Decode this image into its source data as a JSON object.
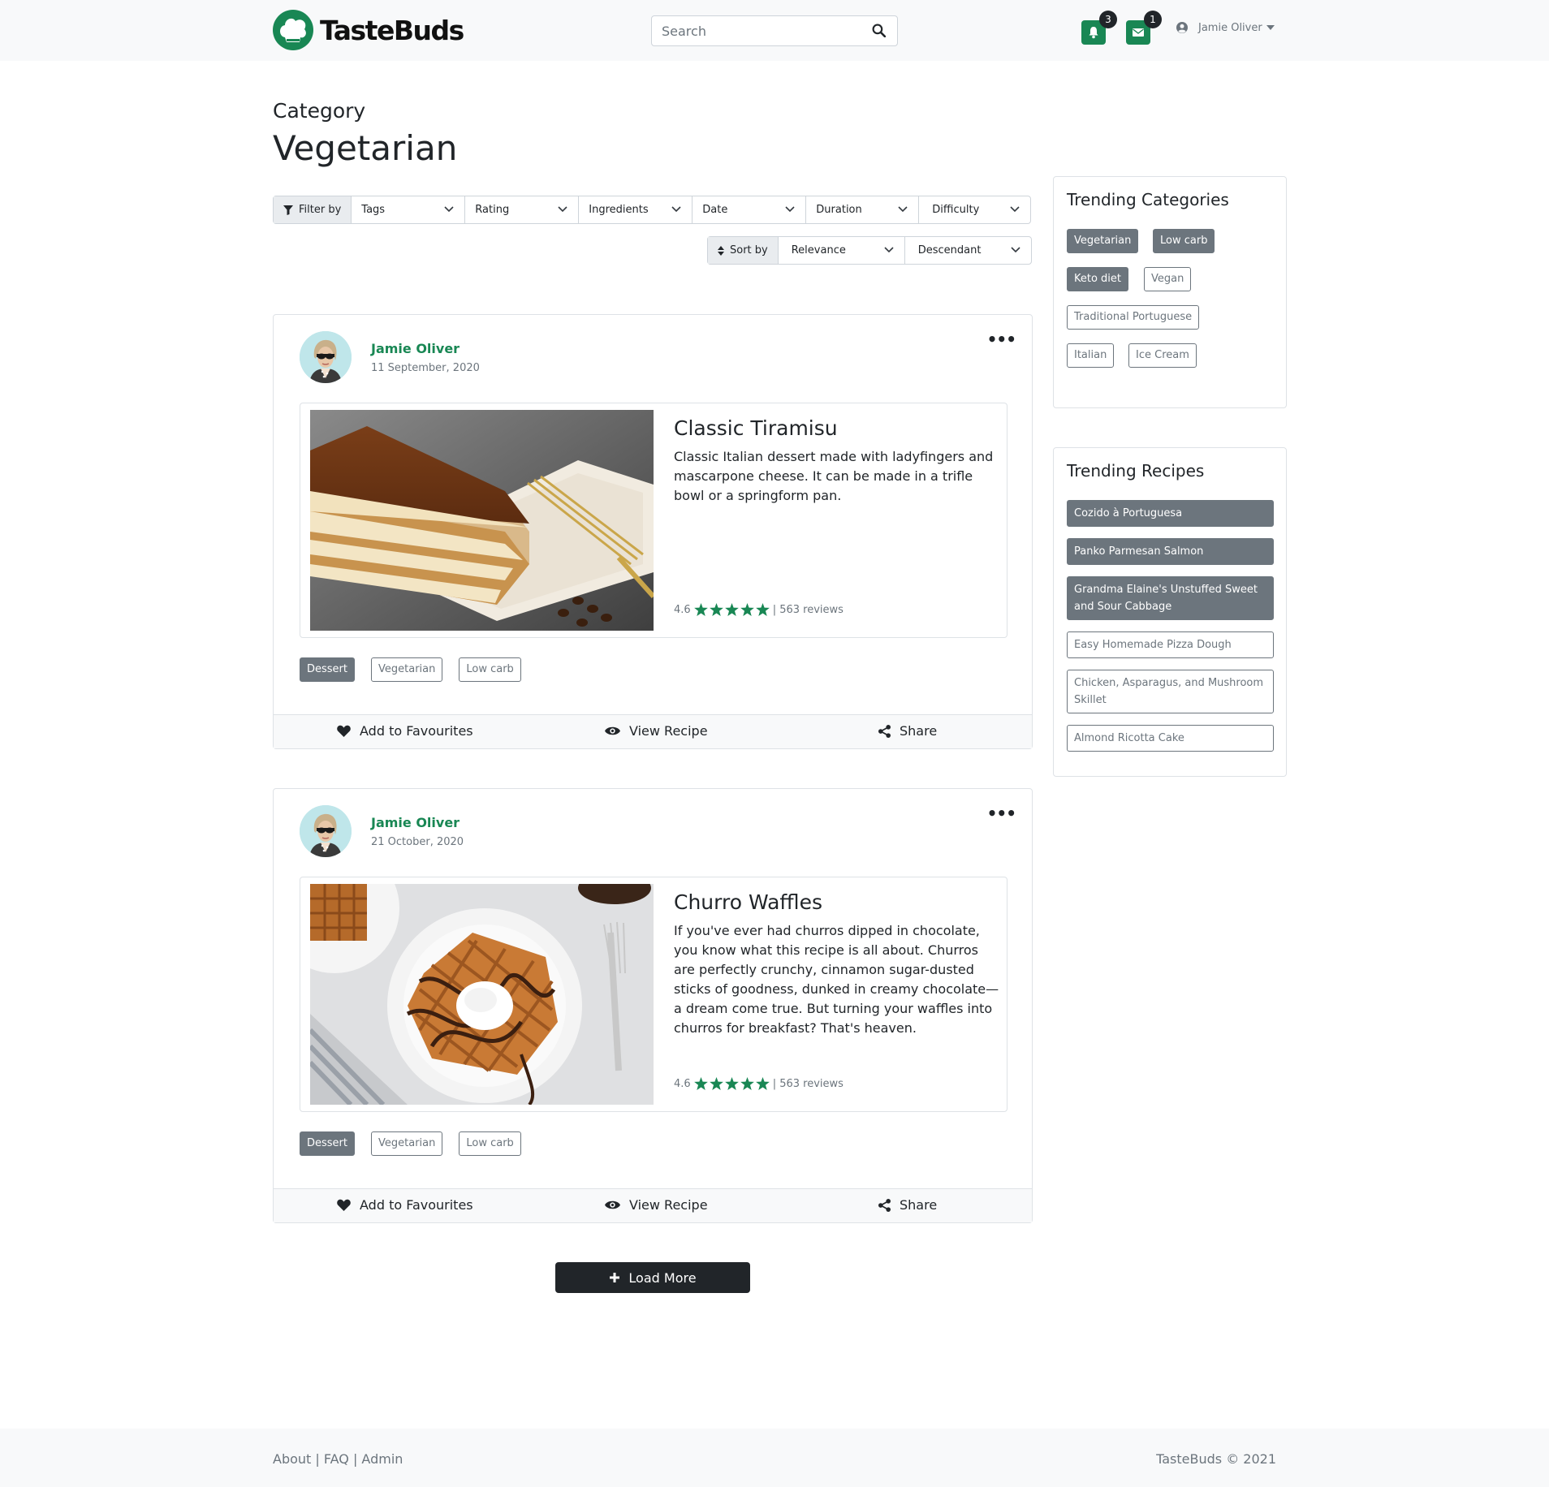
{
  "brand": {
    "name": "TasteBuds",
    "color": "#198754"
  },
  "search": {
    "placeholder": "Search"
  },
  "notifications": {
    "count": "3"
  },
  "messages": {
    "count": "1"
  },
  "user": {
    "name": "Jamie Oliver"
  },
  "page": {
    "category_label": "Category",
    "category_name": "Vegetarian"
  },
  "filters": {
    "label": "Filter by",
    "items": [
      "Tags",
      "Rating",
      "Ingredients",
      "Date",
      "Duration",
      "Difficulty"
    ]
  },
  "sort": {
    "label": "Sort by",
    "field": "Relevance",
    "order": "Descendant"
  },
  "posts": [
    {
      "author": "Jamie Oliver",
      "date": "11 September, 2020",
      "title": "Classic Tiramisu",
      "description": "Classic Italian dessert made with ladyfingers and mascarpone cheese. It can be made in a trifle bowl or a springform pan.",
      "rating": "4.6",
      "stars": 5,
      "reviews": "| 563 reviews",
      "tags": [
        "Dessert",
        "Vegetarian",
        "Low carb"
      ],
      "image": "tiramisu-photo"
    },
    {
      "author": "Jamie Oliver",
      "date": "21 October, 2020",
      "title": "Churro Waffles",
      "description": "If you've ever had churros dipped in chocolate, you know what this recipe is all about. Churros are perfectly crunchy, cinnamon sugar-dusted sticks of goodness, dunked in creamy chocolate—a dream come true. But turning your waffles into churros for breakfast? That's heaven.",
      "rating": "4.6",
      "stars": 5,
      "reviews": "| 563 reviews",
      "tags": [
        "Dessert",
        "Vegetarian",
        "Low carb"
      ],
      "image": "churro-waffles-photo"
    }
  ],
  "actions": {
    "favourite": "Add to Favourites",
    "view": "View Recipe",
    "share": "Share"
  },
  "load_more": "Load More",
  "trending_categories": {
    "title": "Trending Categories",
    "items": [
      "Vegetarian",
      "Low carb",
      "Keto diet",
      "Vegan",
      "Traditional Portuguese",
      "Italian",
      "Ice Cream"
    ]
  },
  "trending_recipes": {
    "title": "Trending Recipes",
    "items": [
      "Cozido à Portuguesa",
      "Panko Parmesan Salmon",
      "Grandma Elaine's Unstuffed Sweet and Sour Cabbage",
      "Easy Homemade Pizza Dough",
      "Chicken, Asparagus, and Mushroom Skillet",
      "Almond Ricotta Cake"
    ]
  },
  "footer": {
    "links": "About | FAQ | Admin",
    "copyright": "TasteBuds © 2021"
  }
}
